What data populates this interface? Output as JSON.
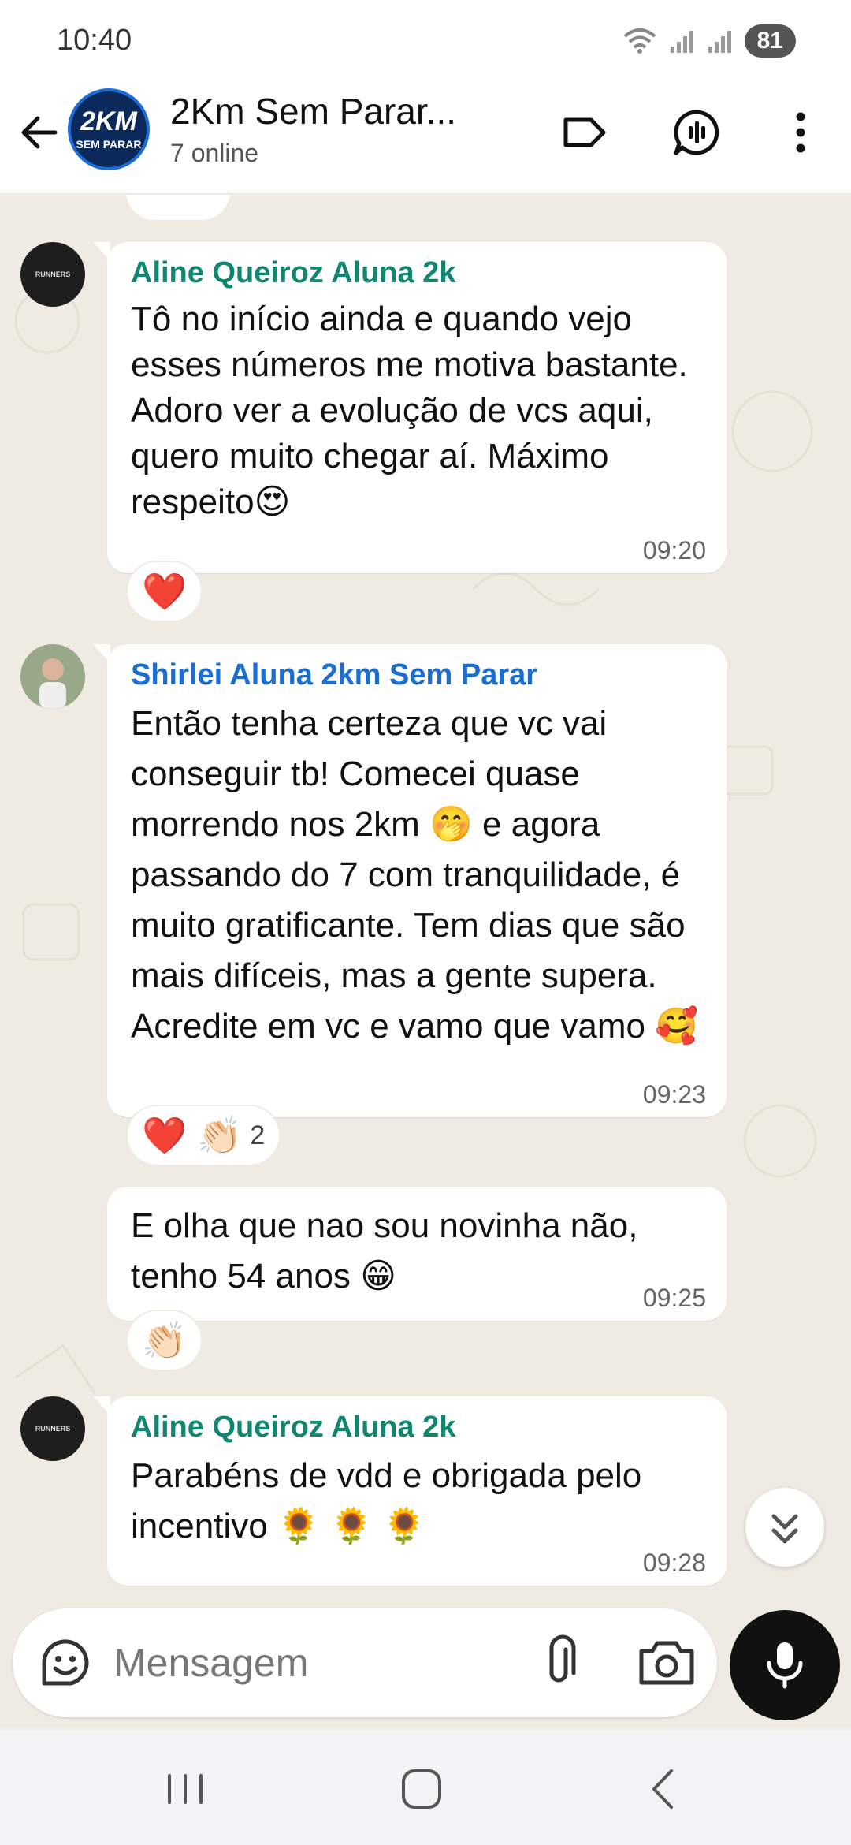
{
  "status": {
    "time": "10:40",
    "battery": "81"
  },
  "header": {
    "avatar_line1": "2KM",
    "avatar_line2": "SEM PARAR",
    "title": "2Km Sem Parar...",
    "subtitle": "7 online"
  },
  "messages": [
    {
      "sender": "Aline Queiroz Aluna 2k",
      "text": "Tô no início ainda e quando vejo esses números me motiva bastante. Adoro ver a evolução de vcs aqui, quero muito chegar aí. Máximo respeito😍",
      "time": "09:20",
      "reactions": "❤️"
    },
    {
      "sender": "Shirlei Aluna 2km Sem Parar",
      "text": "Então tenha certeza que vc vai conseguir tb!  Comecei quase morrendo nos 2km 🤭 e agora passando do 7 com tranquilidade, é muito gratificante. Tem dias que são mais difíceis,  mas a gente supera. Acredite em vc e vamo que vamo 🥰",
      "time": "09:23",
      "reactions": "❤️ 👏🏻",
      "reaction_count": "2"
    },
    {
      "text": "E olha que nao sou novinha não, tenho 54 anos 😁",
      "time": "09:25",
      "reactions": "👏🏻"
    },
    {
      "sender": "Aline Queiroz Aluna 2k",
      "text": "Parabéns de vdd e obrigada pelo incentivo 🌻 🌻 🌻",
      "time": "09:28"
    }
  ],
  "composer": {
    "placeholder": "Mensagem"
  },
  "icons": {
    "back": "arrow-left-icon",
    "label": "label-icon",
    "call": "voice-chat-icon",
    "more": "more-vert-icon",
    "sticker": "sticker-icon",
    "attach": "paperclip-icon",
    "camera": "camera-icon",
    "mic": "mic-icon",
    "scroll": "chevron-double-down-icon"
  },
  "colors": {
    "sender_teal": "#10856f",
    "sender_blue": "#1a6ed0",
    "chat_bg": "#efeae2"
  }
}
